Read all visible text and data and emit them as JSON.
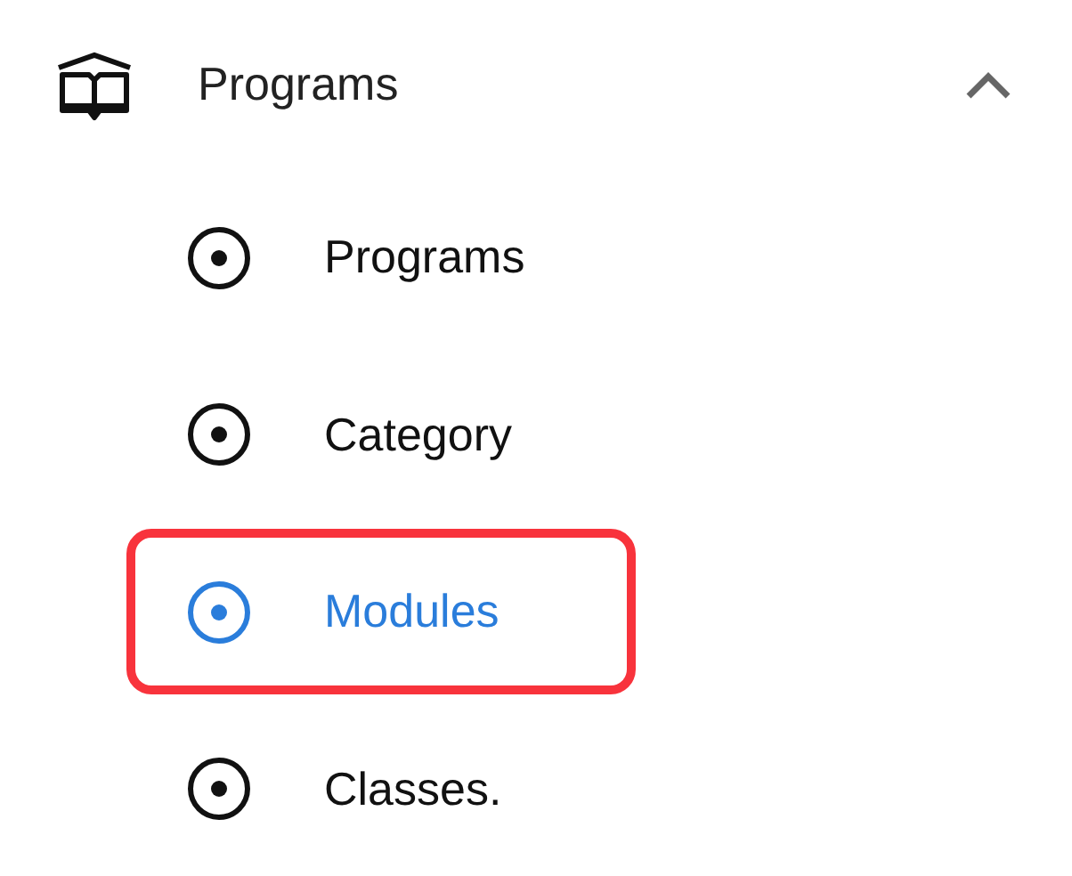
{
  "group": {
    "label": "Programs",
    "expanded": true
  },
  "items": [
    {
      "label": "Programs",
      "selected": false,
      "annotated": false
    },
    {
      "label": "Category",
      "selected": false,
      "annotated": false
    },
    {
      "label": "Modules",
      "selected": true,
      "annotated": true
    },
    {
      "label": "Classes.",
      "selected": false,
      "annotated": false
    }
  ]
}
